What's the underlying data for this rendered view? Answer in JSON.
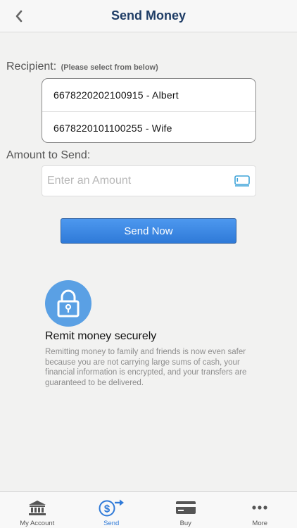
{
  "header": {
    "title": "Send Money",
    "back_icon": "chevron-left-icon"
  },
  "recipient": {
    "label": "Recipient:",
    "hint": "(Please select from below)",
    "options": [
      {
        "label": "6678220202100915 - Albert"
      },
      {
        "label": "6678220101100255 - Wife"
      }
    ]
  },
  "amount": {
    "label": "Amount to Send:",
    "placeholder": "Enter an Amount",
    "value": "",
    "icon": "card-keypad-icon"
  },
  "send_button": {
    "label": "Send Now"
  },
  "secure": {
    "icon": "lock-icon",
    "title": "Remit money securely",
    "text": "Remitting money to family and friends is now even safer because you are not carrying large sums of cash, your financial information is encrypted, and your transfers are guaranteed to be delivered."
  },
  "tabs": [
    {
      "label": "My Account",
      "icon": "bank-icon",
      "active": false
    },
    {
      "label": "Send",
      "icon": "send-dollar-icon",
      "active": true
    },
    {
      "label": "Buy",
      "icon": "credit-card-icon",
      "active": false
    },
    {
      "label": "More",
      "icon": "more-dots-icon",
      "active": false
    }
  ],
  "colors": {
    "accent": "#2f7ad8",
    "title": "#1f3d66",
    "badge": "#5aa0e4"
  }
}
